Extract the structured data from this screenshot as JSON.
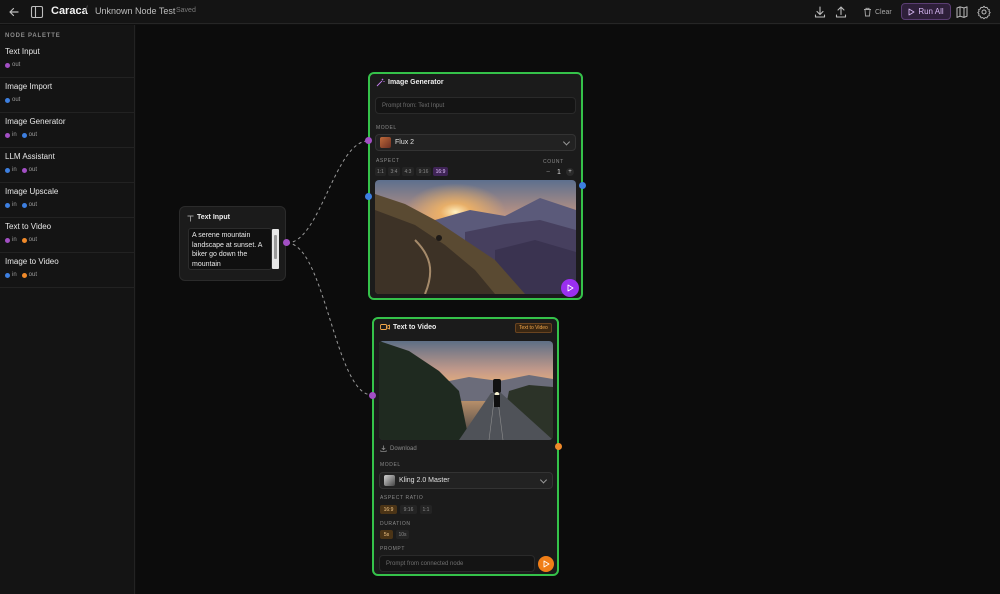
{
  "app": {
    "title": "Caraca",
    "separator": "/",
    "document": "Unknown Node Test",
    "save_status": "Saved"
  },
  "toolbar": {
    "clear_label": "Clear",
    "run_all_label": "Run All",
    "icons": [
      "back-arrow-icon",
      "panel-toggle-icon",
      "download-icon",
      "upload-icon",
      "trash-icon",
      "play-icon",
      "map-icon",
      "settings-gear-icon"
    ]
  },
  "palette": {
    "heading": "NODE PALETTE",
    "items": [
      {
        "label": "Text Input",
        "ports": [
          {
            "dir": "out",
            "color": "#a24fc4"
          }
        ]
      },
      {
        "label": "Image Import",
        "ports": [
          {
            "dir": "out",
            "color": "#3d7fe0"
          }
        ]
      },
      {
        "label": "Image Generator",
        "ports": [
          {
            "dir": "in",
            "color": "#a24fc4"
          },
          {
            "dir": "out",
            "color": "#3d7fe0"
          }
        ]
      },
      {
        "label": "LLM Assistant",
        "ports": [
          {
            "dir": "in",
            "color": "#3d7fe0"
          },
          {
            "dir": "out",
            "color": "#a24fc4"
          }
        ]
      },
      {
        "label": "Image Upscale",
        "ports": [
          {
            "dir": "in",
            "color": "#3d7fe0"
          },
          {
            "dir": "out",
            "color": "#3d7fe0"
          }
        ]
      },
      {
        "label": "Text to Video",
        "ports": [
          {
            "dir": "in",
            "color": "#a24fc4"
          },
          {
            "dir": "out",
            "color": "#f08a2a"
          }
        ]
      },
      {
        "label": "Image to Video",
        "ports": [
          {
            "dir": "in",
            "color": "#3d7fe0"
          },
          {
            "dir": "out",
            "color": "#f08a2a"
          }
        ]
      }
    ],
    "in_word": "in",
    "out_word": "out"
  },
  "text_input_node": {
    "title": "Text Input",
    "value": "A serene mountain landscape at sunset. A biker go down the mountain"
  },
  "image_generator_node": {
    "title": "Image Generator",
    "prompt_placeholder": "Prompt from: Text Input",
    "model_label": "MODEL",
    "model_value": "Flux 2",
    "aspect_label": "ASPECT",
    "aspect_options": [
      "1:1",
      "3:4",
      "4:3",
      "9:16",
      "16:9"
    ],
    "aspect_selected": "16:9",
    "count_label": "COUNT",
    "count_minus": "−",
    "count_value": "1",
    "count_plus": "+"
  },
  "text_to_video_node": {
    "title": "Text to Video",
    "badge": "Text to Video",
    "download_label": "Download",
    "model_label": "MODEL",
    "model_value": "Kling 2.0 Master",
    "aspect_label": "ASPECT RATIO",
    "aspect_options": [
      "16:9",
      "9:16",
      "1:1"
    ],
    "aspect_selected": "16:9",
    "duration_label": "DURATION",
    "duration_options": [
      "5s",
      "10s"
    ],
    "duration_selected": "5s",
    "prompt_label": "PROMPT",
    "prompt_placeholder": "Prompt from connected node"
  },
  "colors": {
    "text_port": "#a24fc4",
    "image_port": "#3d7fe0",
    "video_port": "#f08a2a",
    "selected_border": "#35c24a",
    "run_accent": "#9a2ff0"
  }
}
